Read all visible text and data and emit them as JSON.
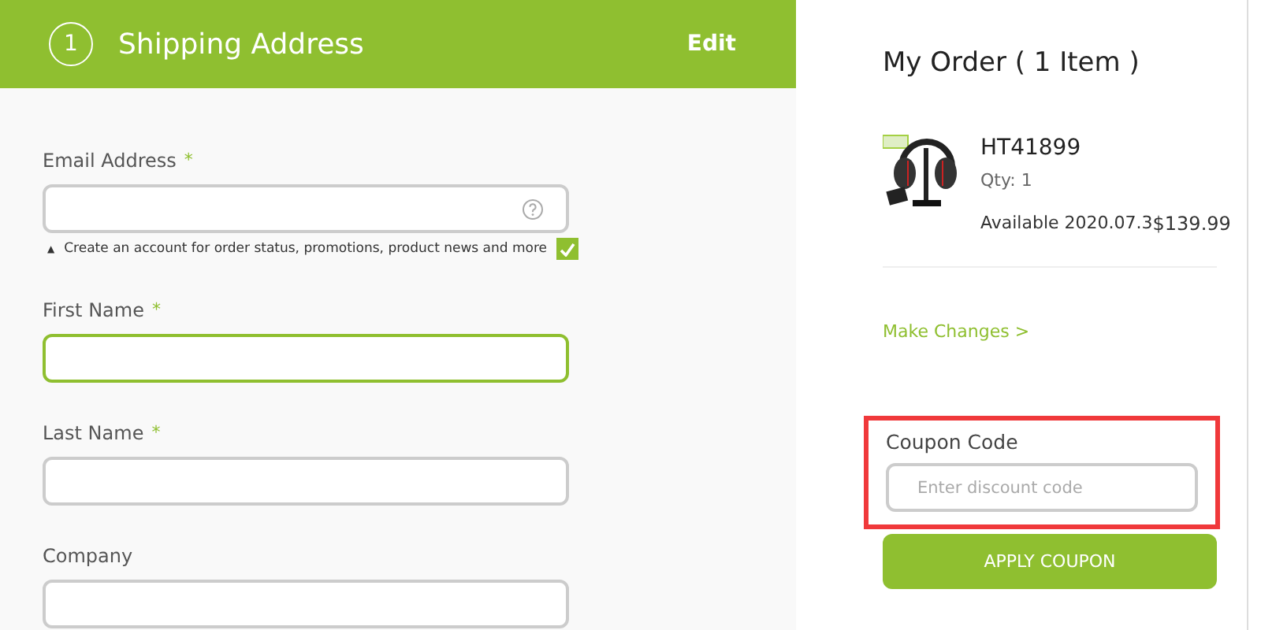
{
  "shipping": {
    "step": "1",
    "title": "Shipping Address",
    "edit": "Edit",
    "fields": [
      {
        "label": "Email Address",
        "required_mark": "*",
        "focused": false,
        "help": true,
        "hint": {
          "arrow": "▲",
          "text": "Create an account for order status, promotions, product news and more",
          "checked": true
        }
      },
      {
        "label": "First Name",
        "required_mark": "*",
        "focused": true,
        "help": false
      },
      {
        "label": "Last Name",
        "required_mark": "*",
        "focused": false,
        "help": false
      },
      {
        "label": "Company",
        "focused": false,
        "help": false
      }
    ]
  },
  "order": {
    "title": "My Order ( 1 Item )",
    "item": {
      "kind": "picture",
      "sku": "HT41899",
      "qty": "Qty: 1",
      "availability": "Available 2020.07.3",
      "price": "$139.99"
    },
    "make_changes": "Make Changes >",
    "coupon": {
      "label": "Coupon Code",
      "placeholder": "Enter discount code",
      "highlighted": true,
      "button": "APPLY COUPON"
    }
  }
}
